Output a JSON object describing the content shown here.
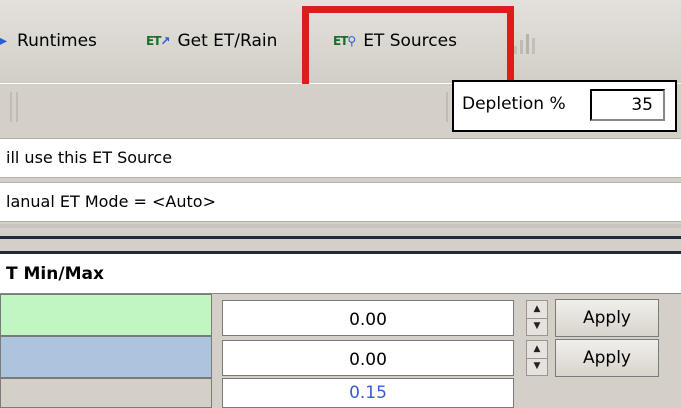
{
  "toolbar": {
    "runtimes_label": "Runtimes",
    "get_et_rain_icon": "ET",
    "get_et_rain_label": "Get ET/Rain",
    "et_sources_icon": "ET",
    "et_sources_label": "ET Sources"
  },
  "depletion": {
    "label": "Depletion %",
    "value": "35"
  },
  "info": {
    "line1": "ill use this ET Source",
    "line2": "lanual ET   Mode = <Auto>"
  },
  "section": {
    "title": "T Min/Max"
  },
  "rows": [
    {
      "color": "#c1f5c1",
      "value": "0.00",
      "apply_label": "Apply"
    },
    {
      "color": "#adc4de",
      "value": "0.00",
      "apply_label": "Apply"
    },
    {
      "color": "#d4d0c8",
      "value": "0.15"
    }
  ],
  "colors": {
    "highlight": "#dd1c1c",
    "third_row_value": "#3a5bd9"
  }
}
